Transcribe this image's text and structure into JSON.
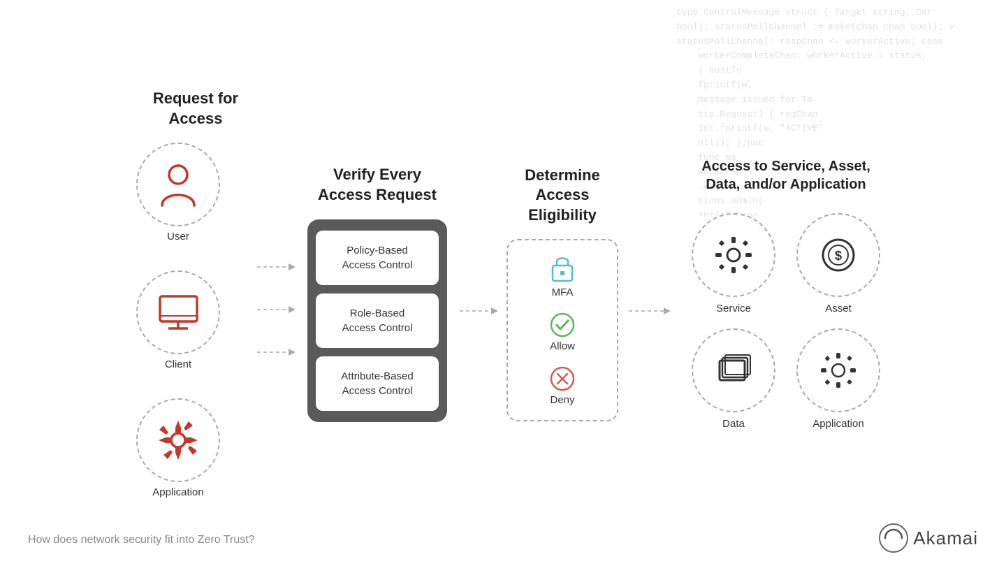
{
  "code_bg": "type ControlMessage struct { Target string; Cor\nbool); statusPollChannel := make(chan chan bool); v\nstatusPollChannel: respChan <- workerActive; case\n    workerCompleteChan: workerActive = status;\n    { hostTo\n    fprintf(w,\n    message issued for Ta\n    ttp.Request) { reqChan\n    Int.fprintf(w, \"ACTIVE\"\n    nil)); };pac\n    func ma\n    workerAp\n    .msg =\n    tions.admin(\n    intToTekeng\n    fprintf(",
  "col1": {
    "title": "Request for Access",
    "items": [
      {
        "label": "User"
      },
      {
        "label": "Client"
      },
      {
        "label": "Application"
      }
    ]
  },
  "col2": {
    "title": "Verify Every\nAccess Request",
    "items": [
      {
        "label": "Policy-Based\nAccess Control"
      },
      {
        "label": "Role-Based\nAccess Control"
      },
      {
        "label": "Attribute-Based\nAccess Control"
      }
    ]
  },
  "col3": {
    "title": "Determine\nAccess Eligibility",
    "items": [
      {
        "label": "MFA"
      },
      {
        "label": "Allow"
      },
      {
        "label": "Deny"
      }
    ]
  },
  "col4": {
    "title": "Access to Service, Asset,\nData, and/or Application",
    "items": [
      {
        "label": "Service"
      },
      {
        "label": "Asset"
      },
      {
        "label": "Data"
      },
      {
        "label": "Application"
      }
    ]
  },
  "bottom_text": "How does network security fit into Zero Trust?",
  "akamai_label": "Akamai"
}
